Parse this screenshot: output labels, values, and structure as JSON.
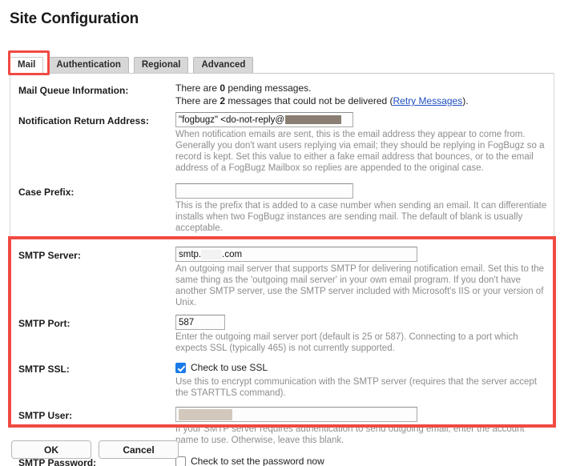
{
  "page": {
    "title": "Site Configuration"
  },
  "tabs": [
    {
      "label": "Mail",
      "active": true
    },
    {
      "label": "Authentication",
      "active": false
    },
    {
      "label": "Regional",
      "active": false
    },
    {
      "label": "Advanced",
      "active": false
    }
  ],
  "form": {
    "mail_queue": {
      "label": "Mail Queue Information:",
      "pending_prefix": "There are ",
      "pending_count": "0",
      "pending_suffix": " pending messages.",
      "failed_prefix": "There are ",
      "failed_count": "2",
      "failed_mid": " messages that could not be delivered (",
      "retry_link": "Retry Messages",
      "failed_suffix": ")."
    },
    "notification_return_address": {
      "label": "Notification Return Address:",
      "value": "\"fogbugz\" <do-not-reply@",
      "redacted": true,
      "help": "When notification emails are sent, this is the email address they appear to come from. Generally you don't want users replying via email; they should be replying in FogBugz so a record is kept. Set this value to either a fake email address that bounces, or to the email address of a FogBugz Mailbox so replies are appended to the original case."
    },
    "case_prefix": {
      "label": "Case Prefix:",
      "value": "",
      "help": "This is the prefix that is added to a case number when sending an email. It can differentiate installs when two FogBugz instances are sending mail. The default of blank is usually acceptable."
    },
    "smtp_server": {
      "label": "SMTP Server:",
      "value_before": "smtp.",
      "value_after": ".com",
      "redacted": true,
      "help": "An outgoing mail server that supports SMTP for delivering notification email. Set this to the same thing as the 'outgoing mail server' in your own email program. If you don't have another SMTP server, use the SMTP server included with Microsoft's IIS or your version of Unix."
    },
    "smtp_port": {
      "label": "SMTP Port:",
      "value": "587",
      "help": "Enter the outgoing mail server port (default is 25 or 587). Connecting to a port which expects SSL (typically 465) is not currently supported."
    },
    "smtp_ssl": {
      "label": "SMTP SSL:",
      "checkbox_label": "Check to use SSL",
      "checked": true,
      "help": "Use this to encrypt communication with the SMTP server (requires that the server accept the STARTTLS command)."
    },
    "smtp_user": {
      "label": "SMTP User:",
      "value": "",
      "redacted": true,
      "help": "If your SMTP server requires authentication to send outgoing email, enter the account name to use. Otherwise, leave this blank."
    },
    "smtp_password": {
      "label": "SMTP Password:",
      "checkbox_label": "Check to set the password now",
      "checked": false
    }
  },
  "buttons": {
    "ok": "OK",
    "cancel": "Cancel"
  },
  "annotations": {
    "highlight_color": "#f04a42",
    "tab_highlight_target": "Mail",
    "region_highlight_target": "SMTP settings"
  }
}
